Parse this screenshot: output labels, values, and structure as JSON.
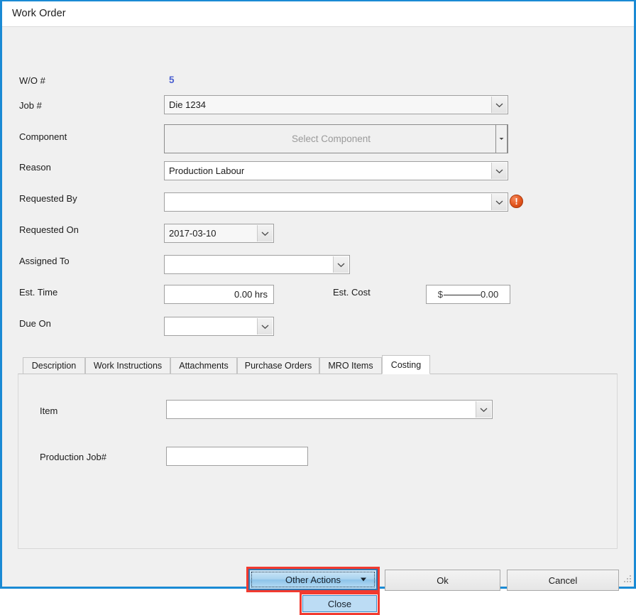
{
  "window": {
    "title": "Work Order",
    "accent_border_color": "#1a8ad4",
    "background_color": "#f0f0f0"
  },
  "form": {
    "wo_number": {
      "label": "W/O #",
      "value": "5",
      "value_color": "#4a5fd0"
    },
    "job_number": {
      "label": "Job #",
      "value": "Die 1234"
    },
    "component": {
      "label": "Component",
      "placeholder": "Select Component",
      "value": ""
    },
    "reason": {
      "label": "Reason",
      "value": "Production Labour"
    },
    "requested_by": {
      "label": "Requested By",
      "value": "",
      "error_icon": "error-exclamation-icon",
      "error_color": "#e3551d"
    },
    "requested_on": {
      "label": "Requested On",
      "value": "2017-03-10"
    },
    "assigned_to": {
      "label": "Assigned To",
      "value": ""
    },
    "est_time": {
      "label": "Est. Time",
      "value": "0.00 hrs"
    },
    "est_cost": {
      "label": "Est. Cost",
      "currency_symbol": "$",
      "value": "0.00"
    },
    "due_on": {
      "label": "Due On",
      "value": ""
    }
  },
  "tabs": {
    "items": [
      {
        "label": "Description",
        "active": false
      },
      {
        "label": "Work Instructions",
        "active": false
      },
      {
        "label": "Attachments",
        "active": false
      },
      {
        "label": "Purchase Orders",
        "active": false
      },
      {
        "label": "MRO Items",
        "active": false
      },
      {
        "label": "Costing",
        "active": true
      }
    ],
    "active_label": "Costing"
  },
  "costing_panel": {
    "item": {
      "label": "Item",
      "value": ""
    },
    "production_job": {
      "label": "Production Job#",
      "value": ""
    }
  },
  "footer": {
    "other_actions": {
      "label": "Other Actions",
      "caret_icon": "caret-down-icon",
      "highlight_color": "#f23a2f",
      "focused": true
    },
    "close_menu_item": {
      "label": "Close",
      "highlight_color": "#f23a2f",
      "selected": true
    },
    "ok": {
      "label": "Ok"
    },
    "cancel": {
      "label": "Cancel"
    }
  },
  "resize_grip": {
    "icon": "resize-grip-icon"
  }
}
